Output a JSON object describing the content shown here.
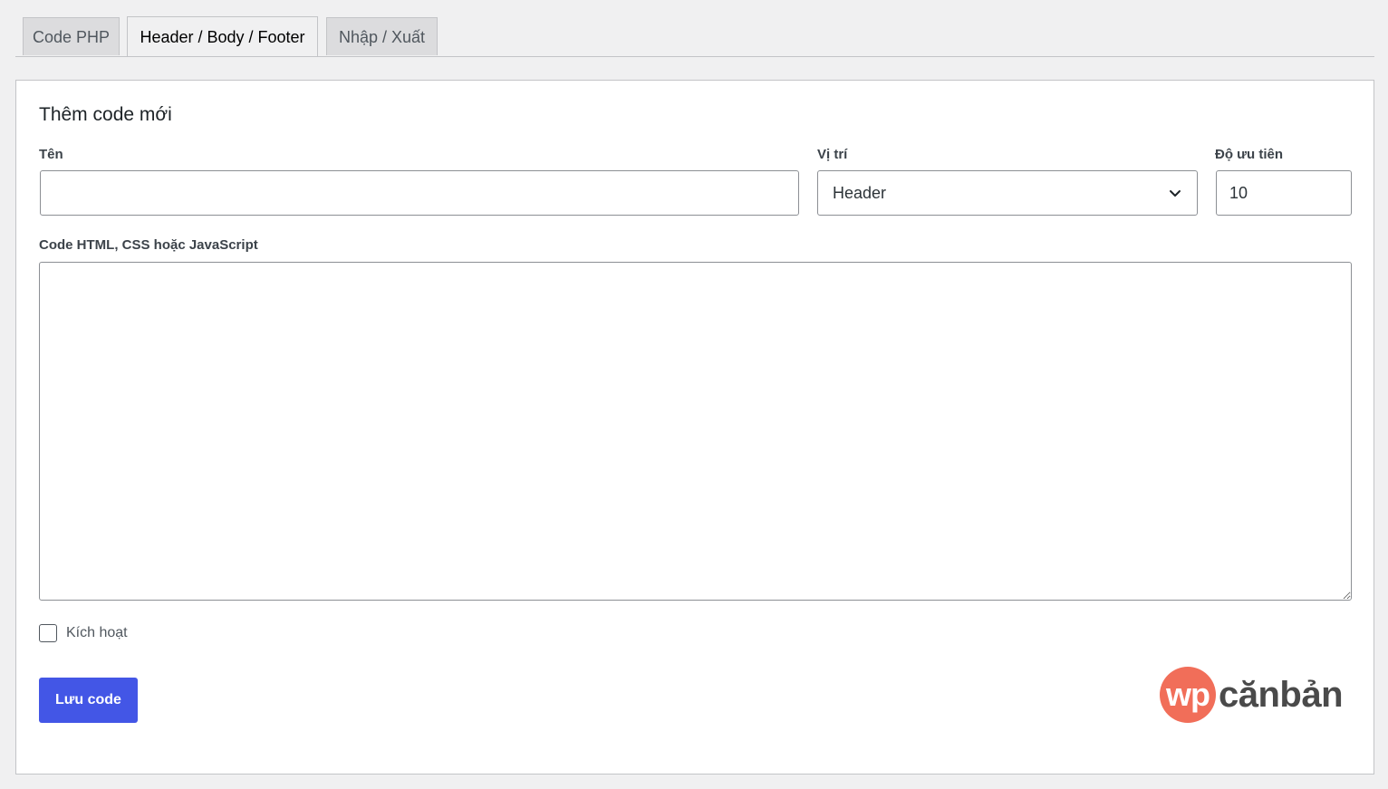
{
  "tabs": [
    {
      "label": "Code PHP",
      "active": false
    },
    {
      "label": "Header / Body / Footer",
      "active": true
    },
    {
      "label": "Nhập / Xuất",
      "active": false
    }
  ],
  "form": {
    "title": "Thêm code mới",
    "name_label": "Tên",
    "name_value": "",
    "position_label": "Vị trí",
    "position_value": "Header",
    "priority_label": "Độ ưu tiên",
    "priority_value": "10",
    "code_label": "Code HTML, CSS hoặc JavaScript",
    "code_value": "",
    "active_label": "Kích hoạt",
    "active_checked": false,
    "save_label": "Lưu code"
  },
  "logo": {
    "mark": "wp",
    "text": "cănbản"
  },
  "colors": {
    "accent": "#4356e6",
    "logo_mark": "#f16e59",
    "background": "#f0f0f1"
  }
}
